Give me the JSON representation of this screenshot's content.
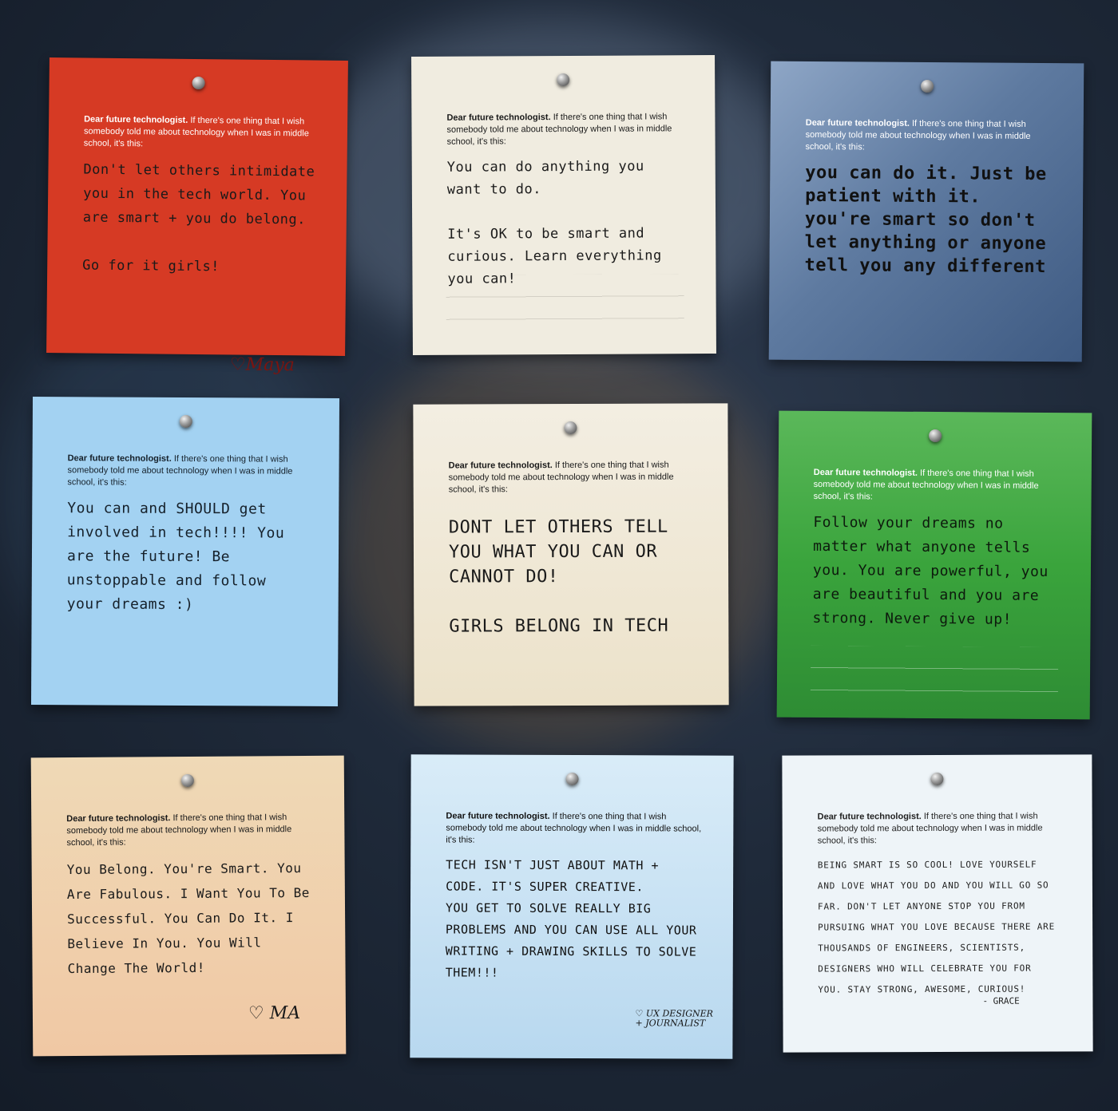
{
  "notes": [
    {
      "prompt_bold": "Dear future technologist.",
      "prompt_rest": "If there's one thing that I wish somebody told me about technology when I was in middle school, it's this:",
      "message": "Don't let others intimidate you in the tech world. You are smart + you do belong.\n\nGo for it girls!",
      "signature": "♡Maya",
      "color": "#d63a24"
    },
    {
      "prompt_bold": "Dear future technologist.",
      "prompt_rest": "If there's one thing that I wish somebody told me about technology when I was in middle school, it's this:",
      "message": "You can do anything you want to do.\n\nIt's OK to be smart and curious. Learn everything you can!",
      "signature": "",
      "color": "#f0ece0"
    },
    {
      "prompt_bold": "Dear future technologist.",
      "prompt_rest": "If there's one thing that I wish somebody told me about technology when I was in middle school, it's this:",
      "message": "you can do it. Just be patient with it. you're smart so don't let anything or anyone tell you any different",
      "signature": "",
      "color": "#5e7aa0"
    },
    {
      "prompt_bold": "Dear future technologist.",
      "prompt_rest": "If there's one thing that I wish somebody told me about technology when I was in middle school, it's this:",
      "message": "You can and SHOULD get involved in tech!!!! You are the future! Be unstoppable and follow your dreams :)",
      "signature": "",
      "color": "#a3d2f2"
    },
    {
      "prompt_bold": "Dear future technologist.",
      "prompt_rest": "If there's one thing that I wish somebody told me about technology when I was in middle school, it's this:",
      "message": "DONT LET OTHERS TELL YOU WHAT YOU CAN OR CANNOT DO!\n\nGIRLS BELONG IN TECH",
      "signature": "",
      "color": "#efe6d4"
    },
    {
      "prompt_bold": "Dear future technologist.",
      "prompt_rest": "If there's one thing that I wish somebody told me about technology when I was in middle school, it's this:",
      "message": "Follow your dreams no matter what anyone tells you. You are powerful, you are beautiful and you are strong. Never give up!",
      "signature": "",
      "color": "#3aa43c"
    },
    {
      "prompt_bold": "Dear future technologist.",
      "prompt_rest": "If there's one thing that I wish somebody told me about technology when I was in middle school, it's this:",
      "message": "You Belong. You're Smart. You Are Fabulous. I Want You To Be Successful. You Can Do It. I Believe In You. You Will Change The World!",
      "signature": "♡ MA",
      "color": "#efd3b0"
    },
    {
      "prompt_bold": "Dear future technologist.",
      "prompt_rest": "If there's one thing that I wish somebody told me about technology when I was in middle school, it's this:",
      "message": "TECH ISN'T JUST ABOUT MATH + CODE. IT'S SUPER CREATIVE.\nYOU GET TO SOLVE REALLY BIG PROBLEMS AND YOU CAN USE ALL YOUR WRITING + DRAWING SKILLS TO SOLVE THEM!!!",
      "signature": "♡ UX DESIGNER + JOURNALIST",
      "color": "#cde4f4"
    },
    {
      "prompt_bold": "Dear future technologist.",
      "prompt_rest": "If there's one thing that I wish somebody told me about technology when I was in middle school, it's this:",
      "message": "BEING SMART IS SO COOL! LOVE YOURSELF AND LOVE WHAT YOU DO AND YOU WILL GO SO FAR. DON'T LET ANYONE STOP YOU FROM PURSUING WHAT YOU LOVE BECAUSE THERE ARE THOUSANDS OF ENGINEERS, SCIENTISTS, DESIGNERS WHO WILL CELEBRATE YOU FOR YOU. STAY STRONG, AWESOME, CURIOUS!",
      "signature": "- GRACE",
      "color": "#eef4f8"
    }
  ]
}
